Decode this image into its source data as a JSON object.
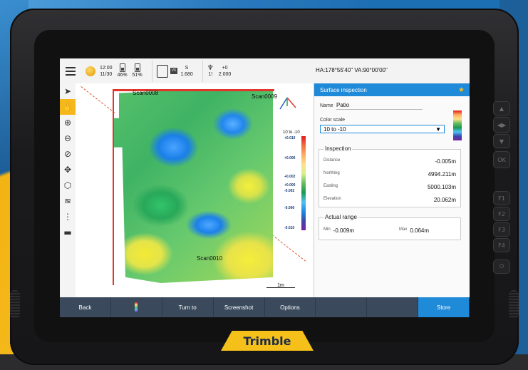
{
  "brand": {
    "logo_text": "Trimble"
  },
  "side_buttons": [
    "▲",
    "◀▶",
    "▼",
    "OK",
    "F1",
    "F2",
    "F3",
    "F4",
    "⏻"
  ],
  "status_bar": {
    "time": "12:00",
    "date": "11/30",
    "battery1": "46%",
    "battery2": "51%",
    "instrument_tag": "VX",
    "instrument_value": "1.680",
    "instrument_label": "S",
    "target_label": "1!",
    "target_offset": "+0",
    "target_height": "2.000",
    "angles": "HA:178°55'40\"  VA:90°00'00\""
  },
  "toolbar": {
    "tools": [
      "select-tool",
      "pan-tool",
      "zoom-in-tool",
      "zoom-out-tool",
      "zoom-extents-tool",
      "orbit-tool",
      "view-cube-tool",
      "layers-tool",
      "more-tool",
      "camera-tool"
    ]
  },
  "view": {
    "scan_labels": [
      "Scan0008",
      "Scan0009",
      "Scan0010"
    ],
    "compass_labels": {
      "n": "N",
      "e": "E"
    },
    "legend_title": "10 to -10",
    "legend_ticks": [
      "+0.010",
      "+0.006",
      "+0.002",
      "+0.000",
      "-0.002",
      "-0.006",
      "-0.010"
    ],
    "scale_label": "1m"
  },
  "panel": {
    "title": "Surface inspection",
    "name_label": "Name",
    "name_value": "Patio",
    "color_scale_label": "Color scale",
    "color_scale_value": "10 to -10",
    "inspection_title": "Inspection",
    "distance_label": "Distance",
    "distance_value": "-0.005m",
    "northing_label": "Northing",
    "northing_value": "4994.211m",
    "easting_label": "Easting",
    "easting_value": "5000.103m",
    "elevation_label": "Elevation",
    "elevation_value": "20.062m",
    "range_title": "Actual range",
    "min_label": "Min",
    "min_value": "-0.009m",
    "max_label": "Max",
    "max_value": "0.064m"
  },
  "bottom_bar": {
    "back": "Back",
    "turn_to": "Turn to",
    "screenshot": "Screenshot",
    "options": "Options",
    "store": "Store"
  },
  "colors": {
    "accent": "#1f8ad8",
    "highlight": "#f5b81a",
    "bottom_bar": "#3a4a5c"
  }
}
